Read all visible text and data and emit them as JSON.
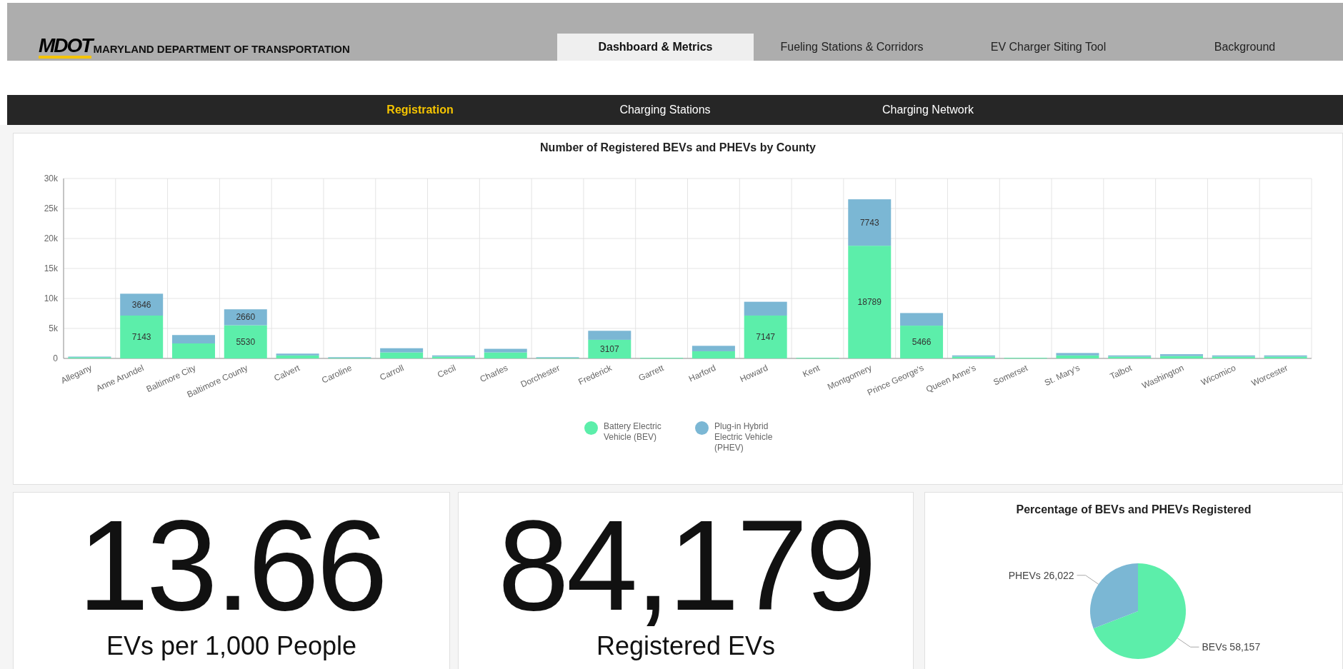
{
  "header": {
    "logo_text": "MDOT",
    "agency": "MARYLAND DEPARTMENT OF TRANSPORTATION",
    "tabs": [
      {
        "label": "Dashboard & Metrics",
        "selected": true
      },
      {
        "label": "Fueling Stations & Corridors",
        "selected": false
      },
      {
        "label": "EV Charger Siting Tool",
        "selected": false
      },
      {
        "label": "Background",
        "selected": false
      }
    ]
  },
  "subnav": {
    "items": [
      {
        "label": "Registration",
        "selected": true
      },
      {
        "label": "Charging Stations",
        "selected": false
      },
      {
        "label": "Charging Network",
        "selected": false
      }
    ]
  },
  "county_chart": {
    "chart_data": {
      "type": "bar",
      "title": "Number of Registered BEVs and PHEVs by County",
      "stacked": true,
      "grid": true,
      "legend": true,
      "categories": [
        "Allegany",
        "Anne Arundel",
        "Baltimore City",
        "Baltimore County",
        "Calvert",
        "Caroline",
        "Carroll",
        "Cecil",
        "Charles",
        "Dorchester",
        "Frederick",
        "Garrett",
        "Harford",
        "Howard",
        "Kent",
        "Montgomery",
        "Prince George's",
        "Queen Anne's",
        "Somerset",
        "St. Mary's",
        "Talbot",
        "Washington",
        "Wicomico",
        "Worcester"
      ],
      "series": [
        {
          "name": "Battery Electric Vehicle (BEV)",
          "color": "#5ceeaa",
          "values": [
            200,
            7143,
            2500,
            5530,
            500,
            100,
            1000,
            300,
            1000,
            100,
            3107,
            100,
            1200,
            7147,
            100,
            18789,
            5466,
            300,
            100,
            500,
            300,
            400,
            300,
            300
          ]
        },
        {
          "name": "Plug-in Hybrid Electric Vehicle (PHEV)",
          "color": "#7bb7d4",
          "values": [
            100,
            3646,
            1400,
            2660,
            300,
            100,
            700,
            200,
            600,
            100,
            1500,
            0,
            900,
            2300,
            0,
            7743,
            2100,
            200,
            0,
            400,
            200,
            300,
            200,
            200
          ]
        }
      ],
      "value_labels": [
        [
          null,
          "7143",
          null,
          "5530",
          null,
          null,
          null,
          null,
          null,
          null,
          "3107",
          null,
          null,
          "7147",
          null,
          "18789",
          "5466",
          null,
          null,
          null,
          null,
          null,
          null,
          null
        ],
        [
          null,
          "3646",
          null,
          "2660",
          null,
          null,
          null,
          null,
          null,
          null,
          null,
          null,
          null,
          null,
          null,
          "7743",
          null,
          null,
          null,
          null,
          null,
          null,
          null,
          null
        ]
      ],
      "ylim": [
        0,
        30000
      ],
      "yticks": [
        {
          "value": 0,
          "label": "0"
        },
        {
          "value": 5000,
          "label": "5k"
        },
        {
          "value": 10000,
          "label": "10k"
        },
        {
          "value": 15000,
          "label": "15k"
        },
        {
          "value": 20000,
          "label": "20k"
        },
        {
          "value": 25000,
          "label": "25k"
        },
        {
          "value": 30000,
          "label": "30k"
        }
      ]
    }
  },
  "stats": [
    {
      "value": "13.66",
      "label": "EVs per 1,000 People"
    },
    {
      "value": "84,179",
      "label": "Registered EVs"
    }
  ],
  "share_chart": {
    "chart_data": {
      "type": "pie",
      "title": "Percentage of BEVs and PHEVs Registered",
      "categories": [
        "BEVs",
        "PHEVs"
      ],
      "values": [
        58157,
        26022
      ],
      "colors": [
        "#5ceeaa",
        "#7bb7d4"
      ],
      "value_labels": [
        "58,157",
        "26,022"
      ]
    }
  }
}
